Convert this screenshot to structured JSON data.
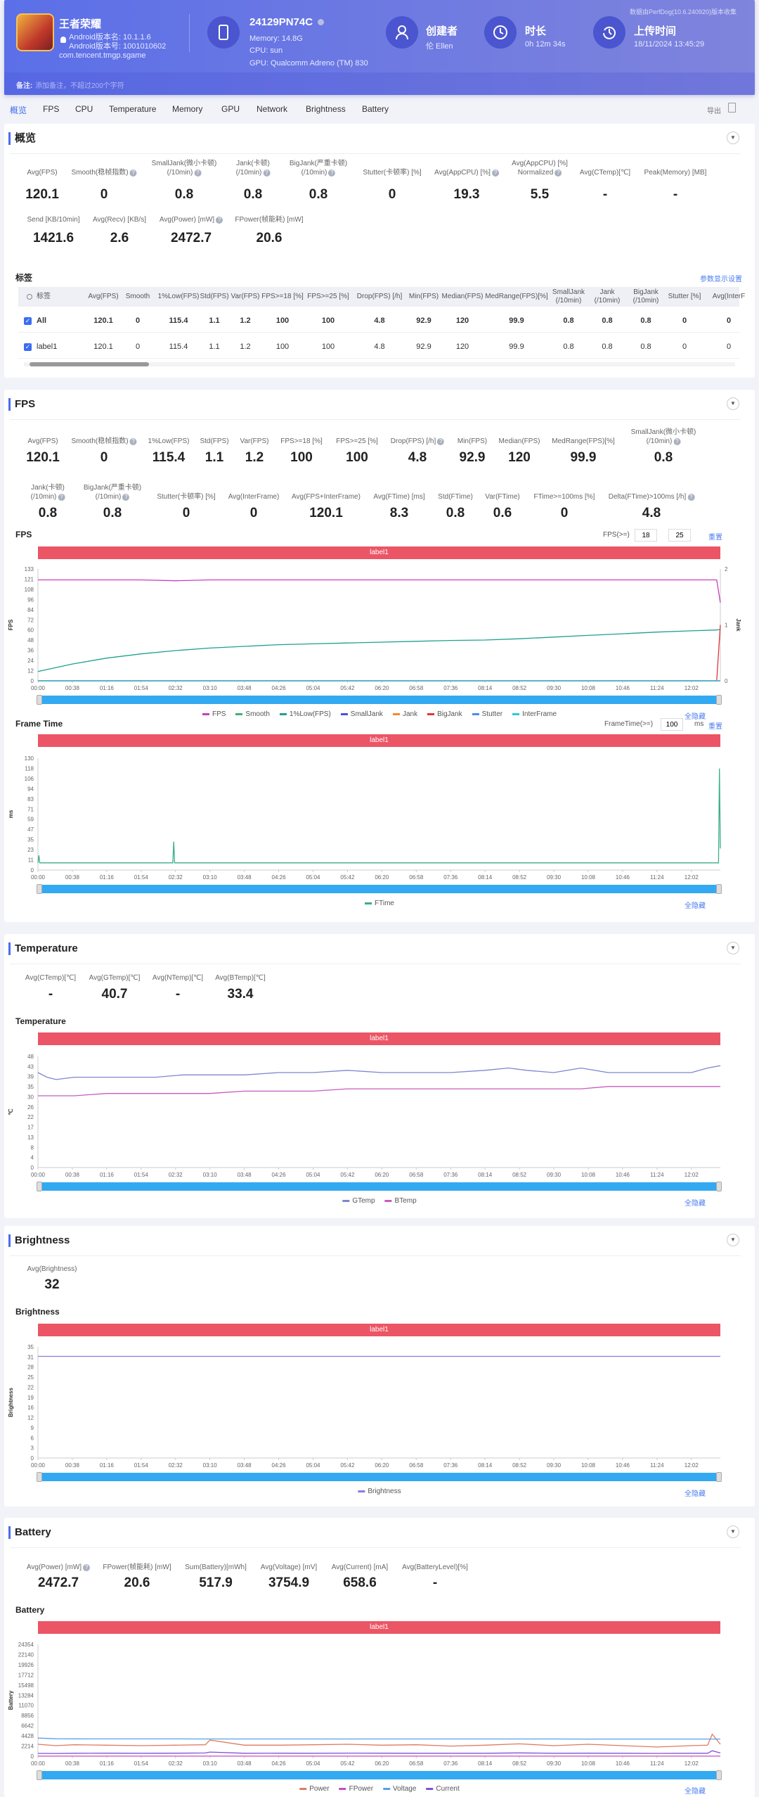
{
  "header": {
    "app_name": "王者荣耀",
    "android_version_name": "Android版本名: 10.1.1.6",
    "android_version_code": "Android版本号: 1001010602",
    "package": "com.tencent.tmgp.sgame",
    "device_model": "24129PN74C",
    "memory": "Memory: 14.8G",
    "cpu": "CPU: sun",
    "gpu": "GPU: Qualcomm Adreno (TM) 830",
    "creator_label": "创建者",
    "creator_value": "伦 Ellen",
    "duration_label": "时长",
    "duration_value": "0h 12m 34s",
    "upload_label": "上传时间",
    "upload_value": "18/11/2024 13:45:29",
    "collected_note": "数据由PerfDog(10.6.240920)版本收集",
    "remark_label": "备注:",
    "remark_placeholder": "添加备注，不超过200个字符"
  },
  "tabs": [
    {
      "label": "概览",
      "active": true
    },
    {
      "label": "FPS"
    },
    {
      "label": "CPU"
    },
    {
      "label": "Temperature"
    },
    {
      "label": "Memory"
    },
    {
      "label": "GPU"
    },
    {
      "label": "Network"
    },
    {
      "label": "Brightness"
    },
    {
      "label": "Battery"
    }
  ],
  "export_label": "导出",
  "overview": {
    "title": "概览",
    "stats": [
      {
        "label": "Avg(FPS)",
        "value": "120.1"
      },
      {
        "label": "Smooth(稳帧指数)",
        "value": "0",
        "help": true
      },
      {
        "label": "SmallJank(微小卡顿)\n(/10min)",
        "value": "0.8",
        "help": true
      },
      {
        "label": "Jank(卡顿)\n(/10min)",
        "value": "0.8",
        "help": true
      },
      {
        "label": "BigJank(严重卡顿)\n(/10min)",
        "value": "0.8",
        "help": true
      },
      {
        "label": "Stutter(卡顿率) [%]",
        "value": "0"
      },
      {
        "label": "Avg(AppCPU) [%]",
        "value": "19.3",
        "help": true
      },
      {
        "label": "Avg(AppCPU) [%]\nNormalized",
        "value": "5.5",
        "help": true
      },
      {
        "label": "Avg(CTemp)[℃]",
        "value": "-"
      },
      {
        "label": "Peak(Memory) [MB]",
        "value": "-"
      }
    ],
    "stats2": [
      {
        "label": "Send [KB/10min]",
        "value": "1421.6"
      },
      {
        "label": "Avg(Recv) [KB/s]",
        "value": "2.6"
      },
      {
        "label": "Avg(Power) [mW]",
        "value": "2472.7",
        "help": true
      },
      {
        "label": "FPower(帧能耗) [mW]",
        "value": "20.6"
      }
    ],
    "tags_title": "标签",
    "param_settings": "参数显示设置",
    "table": {
      "columns": [
        "标签",
        "Avg(FPS)",
        "Smooth",
        "1%Low(FPS)",
        "Std(FPS)",
        "Var(FPS)",
        "FPS>=18 [%]",
        "FPS>=25 [%]",
        "Drop(FPS) [/h]",
        "Min(FPS)",
        "Median(FPS)",
        "MedRange(FPS)[%]",
        "SmallJank\n(/10min)",
        "Jank\n(/10min)",
        "BigJank\n(/10min)",
        "Stutter [%]",
        "Avg(InterF"
      ],
      "rows": [
        [
          "All",
          "120.1",
          "0",
          "115.4",
          "1.1",
          "1.2",
          "100",
          "100",
          "4.8",
          "92.9",
          "120",
          "99.9",
          "0.8",
          "0.8",
          "0.8",
          "0",
          "0"
        ],
        [
          "label1",
          "120.1",
          "0",
          "115.4",
          "1.1",
          "1.2",
          "100",
          "100",
          "4.8",
          "92.9",
          "120",
          "99.9",
          "0.8",
          "0.8",
          "0.8",
          "0",
          "0"
        ]
      ]
    }
  },
  "fps": {
    "title": "FPS",
    "stats": [
      {
        "label": "Avg(FPS)",
        "value": "120.1"
      },
      {
        "label": "Smooth(稳帧指数)",
        "value": "0",
        "help": true
      },
      {
        "label": "1%Low(FPS)",
        "value": "115.4"
      },
      {
        "label": "Std(FPS)",
        "value": "1.1"
      },
      {
        "label": "Var(FPS)",
        "value": "1.2"
      },
      {
        "label": "FPS>=18 [%]",
        "value": "100"
      },
      {
        "label": "FPS>=25 [%]",
        "value": "100"
      },
      {
        "label": "Drop(FPS) [/h]",
        "value": "4.8",
        "help": true
      },
      {
        "label": "Min(FPS)",
        "value": "92.9"
      },
      {
        "label": "Median(FPS)",
        "value": "120"
      },
      {
        "label": "MedRange(FPS)[%]",
        "value": "99.9"
      },
      {
        "label": "SmallJank(微小卡顿)\n(/10min)",
        "value": "0.8",
        "help": true
      }
    ],
    "stats2": [
      {
        "label": "Jank(卡顿)\n(/10min)",
        "value": "0.8",
        "help": true
      },
      {
        "label": "BigJank(严重卡顿)\n(/10min)",
        "value": "0.8",
        "help": true
      },
      {
        "label": "Stutter(卡顿率) [%]",
        "value": "0"
      },
      {
        "label": "Avg(InterFrame)",
        "value": "0"
      },
      {
        "label": "Avg(FPS+InterFrame)",
        "value": "120.1"
      },
      {
        "label": "Avg(FTime) [ms]",
        "value": "8.3"
      },
      {
        "label": "Std(FTime)",
        "value": "0.8"
      },
      {
        "label": "Var(FTime)",
        "value": "0.6"
      },
      {
        "label": "FTime>=100ms [%]",
        "value": "0"
      },
      {
        "label": "Delta(FTime)>100ms [/h]",
        "value": "4.8",
        "help": true
      }
    ],
    "fps_chart_title": "FPS",
    "fps_threshold_label": "FPS(>=)",
    "fps_threshold_1": "18",
    "fps_threshold_2": "25",
    "reset": "重置",
    "ft_chart_title": "Frame Time",
    "ft_threshold_label": "FrameTime(>=)",
    "ft_threshold": "100",
    "ft_unit": "ms"
  },
  "temperature": {
    "title": "Temperature",
    "stats": [
      {
        "label": "Avg(CTemp)[℃]",
        "value": "-"
      },
      {
        "label": "Avg(GTemp)[℃]",
        "value": "40.7"
      },
      {
        "label": "Avg(NTemp)[℃]",
        "value": "-"
      },
      {
        "label": "Avg(BTemp)[℃]",
        "value": "33.4"
      }
    ],
    "chart_title": "Temperature"
  },
  "brightness": {
    "title": "Brightness",
    "stats": [
      {
        "label": "Avg(Brightness)",
        "value": "32"
      }
    ],
    "chart_title": "Brightness"
  },
  "battery": {
    "title": "Battery",
    "stats": [
      {
        "label": "Avg(Power) [mW]",
        "value": "2472.7",
        "help": true
      },
      {
        "label": "FPower(帧能耗) [mW]",
        "value": "20.6"
      },
      {
        "label": "Sum(Battery)[mWh]",
        "value": "517.9"
      },
      {
        "label": "Avg(Voltage) [mV]",
        "value": "3754.9"
      },
      {
        "label": "Avg(Current) [mA]",
        "value": "658.6"
      },
      {
        "label": "Avg(BatteryLevel)[%]",
        "value": "-"
      }
    ],
    "chart_title": "Battery"
  },
  "hide_all": "全隐藏",
  "chart_data": [
    {
      "id": "fps",
      "type": "line",
      "label_band": "label1",
      "ylabel": "FPS",
      "y2label": "Jank",
      "yticks": [
        "0",
        "12",
        "24",
        "36",
        "48",
        "60",
        "72",
        "84",
        "96",
        "108",
        "121",
        "133"
      ],
      "ylim": [
        0,
        133
      ],
      "y2ticks": [
        "0",
        "1",
        "2"
      ],
      "y2lim": [
        0,
        2
      ],
      "xticks": [
        "00:00",
        "00:38",
        "01:16",
        "01:54",
        "02:32",
        "03:10",
        "03:48",
        "04:26",
        "05:04",
        "05:42",
        "06:20",
        "06:58",
        "07:36",
        "08:14",
        "08:52",
        "09:30",
        "10:08",
        "10:46",
        "11:24",
        "12:02"
      ],
      "xmax": "12:34",
      "x": [
        "00:00",
        "00:38",
        "01:16",
        "01:54",
        "02:32",
        "03:10",
        "03:48",
        "04:26",
        "05:04",
        "05:42",
        "06:20",
        "06:58",
        "07:36",
        "08:14",
        "08:52",
        "09:30",
        "10:08",
        "10:46",
        "11:24",
        "12:02",
        "12:30",
        "12:34"
      ],
      "series": [
        {
          "name": "FPS",
          "color": "#c83fbf",
          "values": [
            120,
            120,
            120,
            120,
            119,
            120,
            120,
            120,
            120,
            120,
            120,
            120,
            120,
            120,
            120,
            120,
            120,
            120,
            120,
            120,
            120,
            92.9
          ]
        },
        {
          "name": "Smooth",
          "color": "#3cb371",
          "values": [
            0,
            0,
            0,
            0,
            0,
            0,
            0,
            0,
            0,
            0,
            0,
            0,
            0,
            0,
            0,
            0,
            0,
            0,
            0,
            0,
            0,
            0
          ]
        },
        {
          "name": "1%Low(FPS)",
          "color": "#20a090",
          "values": [
            11,
            20,
            27,
            32,
            36,
            39,
            41,
            43,
            44,
            45,
            46,
            47,
            48,
            48.5,
            50,
            52,
            54,
            56,
            58,
            59.5,
            60.5,
            61
          ]
        },
        {
          "name": "SmallJank",
          "color": "#4b4fe0",
          "values": [
            0,
            0,
            0,
            0,
            0,
            0,
            0,
            0,
            0,
            0,
            0,
            0,
            0,
            0,
            0,
            0,
            0,
            0,
            0,
            0,
            0,
            0
          ]
        },
        {
          "name": "Jank",
          "color": "#f08a30",
          "values": [
            0,
            0,
            0,
            0,
            0,
            0,
            0,
            0,
            0,
            0,
            0,
            0,
            0,
            0,
            0,
            0,
            0,
            0,
            0,
            0,
            0,
            0
          ]
        },
        {
          "name": "BigJank",
          "color": "#e0343a",
          "axis": "y2",
          "values": [
            0,
            0,
            0,
            0,
            0,
            0,
            0,
            0,
            0,
            0,
            0,
            0,
            0,
            0,
            0,
            0,
            0,
            0,
            0,
            0,
            0,
            1
          ]
        },
        {
          "name": "Stutter",
          "color": "#4a8cf0",
          "values": [
            0,
            0,
            0,
            0,
            0,
            0,
            0,
            0,
            0,
            0,
            0,
            0,
            0,
            0,
            0,
            0,
            0,
            0,
            0,
            0,
            0,
            0
          ]
        },
        {
          "name": "InterFrame",
          "color": "#30c8d8",
          "values": [
            0,
            0,
            0,
            0,
            0,
            0,
            0,
            0,
            0,
            0,
            0,
            0,
            0,
            0,
            0,
            0,
            0,
            0,
            0,
            0,
            0,
            0
          ]
        }
      ]
    },
    {
      "id": "ftime",
      "type": "line",
      "label_band": "label1",
      "ylabel": "ms",
      "yticks": [
        "0",
        "11",
        "23",
        "35",
        "47",
        "59",
        "71",
        "83",
        "94",
        "106",
        "118",
        "130"
      ],
      "ylim": [
        0,
        130
      ],
      "xticks": [
        "00:00",
        "00:38",
        "01:16",
        "01:54",
        "02:32",
        "03:10",
        "03:48",
        "04:26",
        "05:04",
        "05:42",
        "06:20",
        "06:58",
        "07:36",
        "08:14",
        "08:52",
        "09:30",
        "10:08",
        "10:46",
        "11:24",
        "12:02"
      ],
      "xmax": "12:34",
      "x": [
        "00:00",
        "00:01",
        "00:02",
        "02:29",
        "02:30",
        "02:31",
        "12:32",
        "12:33",
        "12:34"
      ],
      "series": [
        {
          "name": "FTime",
          "color": "#3cae8c",
          "values": [
            8.3,
            17,
            8.3,
            8.3,
            33,
            8.3,
            8.3,
            118,
            25
          ]
        }
      ]
    },
    {
      "id": "temp",
      "type": "line",
      "label_band": "label1",
      "ylabel": "℃",
      "yticks": [
        "0",
        "4",
        "8",
        "13",
        "17",
        "22",
        "26",
        "30",
        "35",
        "39",
        "43",
        "48"
      ],
      "ylim": [
        0,
        48
      ],
      "xticks": [
        "00:00",
        "00:38",
        "01:16",
        "01:54",
        "02:32",
        "03:10",
        "03:48",
        "04:26",
        "05:04",
        "05:42",
        "06:20",
        "06:58",
        "07:36",
        "08:14",
        "08:52",
        "09:30",
        "10:08",
        "10:46",
        "11:24",
        "12:02"
      ],
      "xmax": "12:34",
      "x": [
        "00:00",
        "00:10",
        "00:20",
        "00:40",
        "01:16",
        "02:10",
        "02:40",
        "03:10",
        "03:48",
        "04:26",
        "05:04",
        "05:42",
        "06:20",
        "06:58",
        "07:36",
        "08:14",
        "08:40",
        "09:00",
        "09:30",
        "10:00",
        "10:30",
        "11:00",
        "11:24",
        "12:02",
        "12:20",
        "12:34"
      ],
      "series": [
        {
          "name": "GTemp",
          "color": "#7c86d0",
          "values": [
            41,
            39,
            38,
            39,
            39,
            39,
            40,
            40,
            40,
            41,
            41,
            42,
            41,
            41,
            41,
            42,
            43,
            42,
            41,
            43,
            41,
            41,
            41,
            41,
            43,
            44
          ]
        },
        {
          "name": "BTemp",
          "color": "#c85bc0",
          "values": [
            31,
            31,
            31,
            31,
            32,
            32,
            32,
            32,
            33,
            33,
            33,
            34,
            34,
            34,
            34,
            34,
            34,
            34,
            34,
            34,
            35,
            35,
            35,
            35,
            35,
            35
          ]
        }
      ]
    },
    {
      "id": "bright",
      "type": "line",
      "label_band": "label1",
      "ylabel": "Brightness",
      "yticks": [
        "0",
        "3",
        "6",
        "9",
        "12",
        "16",
        "19",
        "22",
        "25",
        "28",
        "31",
        "35"
      ],
      "ylim": [
        0,
        35
      ],
      "xticks": [
        "00:00",
        "00:38",
        "01:16",
        "01:54",
        "02:32",
        "03:10",
        "03:48",
        "04:26",
        "05:04",
        "05:42",
        "06:20",
        "06:58",
        "07:36",
        "08:14",
        "08:52",
        "09:30",
        "10:08",
        "10:46",
        "11:24",
        "12:02"
      ],
      "xmax": "12:34",
      "x": [
        "00:00",
        "12:34"
      ],
      "series": [
        {
          "name": "Brightness",
          "color": "#8a7be0",
          "values": [
            32,
            32
          ]
        }
      ]
    },
    {
      "id": "batt",
      "type": "line",
      "label_band": "label1",
      "ylabel": "Battery",
      "yticks": [
        "0",
        "2214",
        "4428",
        "6642",
        "8856",
        "11070",
        "13284",
        "15498",
        "17712",
        "19926",
        "22140",
        "24354"
      ],
      "ylim": [
        0,
        24354
      ],
      "xticks": [
        "00:00",
        "00:38",
        "01:16",
        "01:54",
        "02:32",
        "03:10",
        "03:48",
        "04:26",
        "05:04",
        "05:42",
        "06:20",
        "06:58",
        "07:36",
        "08:14",
        "08:52",
        "09:30",
        "10:08",
        "10:46",
        "11:24",
        "12:02"
      ],
      "xmax": "12:34",
      "x": [
        "00:00",
        "00:20",
        "00:40",
        "01:16",
        "01:54",
        "02:32",
        "03:05",
        "03:10",
        "03:48",
        "04:26",
        "05:04",
        "05:42",
        "06:20",
        "06:58",
        "07:36",
        "08:14",
        "08:52",
        "09:30",
        "10:08",
        "10:46",
        "11:24",
        "12:02",
        "12:20",
        "12:25",
        "12:34"
      ],
      "series": [
        {
          "name": "Power",
          "color": "#e07a62",
          "values": [
            2600,
            2300,
            2500,
            2400,
            2300,
            2400,
            2500,
            3500,
            2400,
            2400,
            2500,
            2600,
            2400,
            2500,
            2200,
            2400,
            2700,
            2300,
            2600,
            2300,
            2000,
            2300,
            2400,
            4800,
            2600
          ]
        },
        {
          "name": "FPower",
          "color": "#c84cc0",
          "values": [
            21,
            21,
            21,
            21,
            21,
            21,
            21,
            21,
            21,
            21,
            21,
            21,
            21,
            21,
            21,
            21,
            21,
            21,
            21,
            21,
            21,
            21,
            21,
            21,
            21
          ]
        },
        {
          "name": "Voltage",
          "color": "#5aa0e8",
          "values": [
            3950,
            3800,
            3780,
            3770,
            3770,
            3765,
            3760,
            3760,
            3760,
            3755,
            3755,
            3755,
            3750,
            3750,
            3750,
            3750,
            3750,
            3750,
            3745,
            3745,
            3745,
            3740,
            3740,
            3740,
            3740
          ]
        },
        {
          "name": "Current",
          "color": "#8050d8",
          "values": [
            620,
            600,
            650,
            660,
            640,
            660,
            700,
            900,
            650,
            660,
            650,
            680,
            660,
            650,
            640,
            650,
            720,
            650,
            660,
            640,
            620,
            640,
            650,
            1200,
            700
          ]
        }
      ]
    }
  ]
}
